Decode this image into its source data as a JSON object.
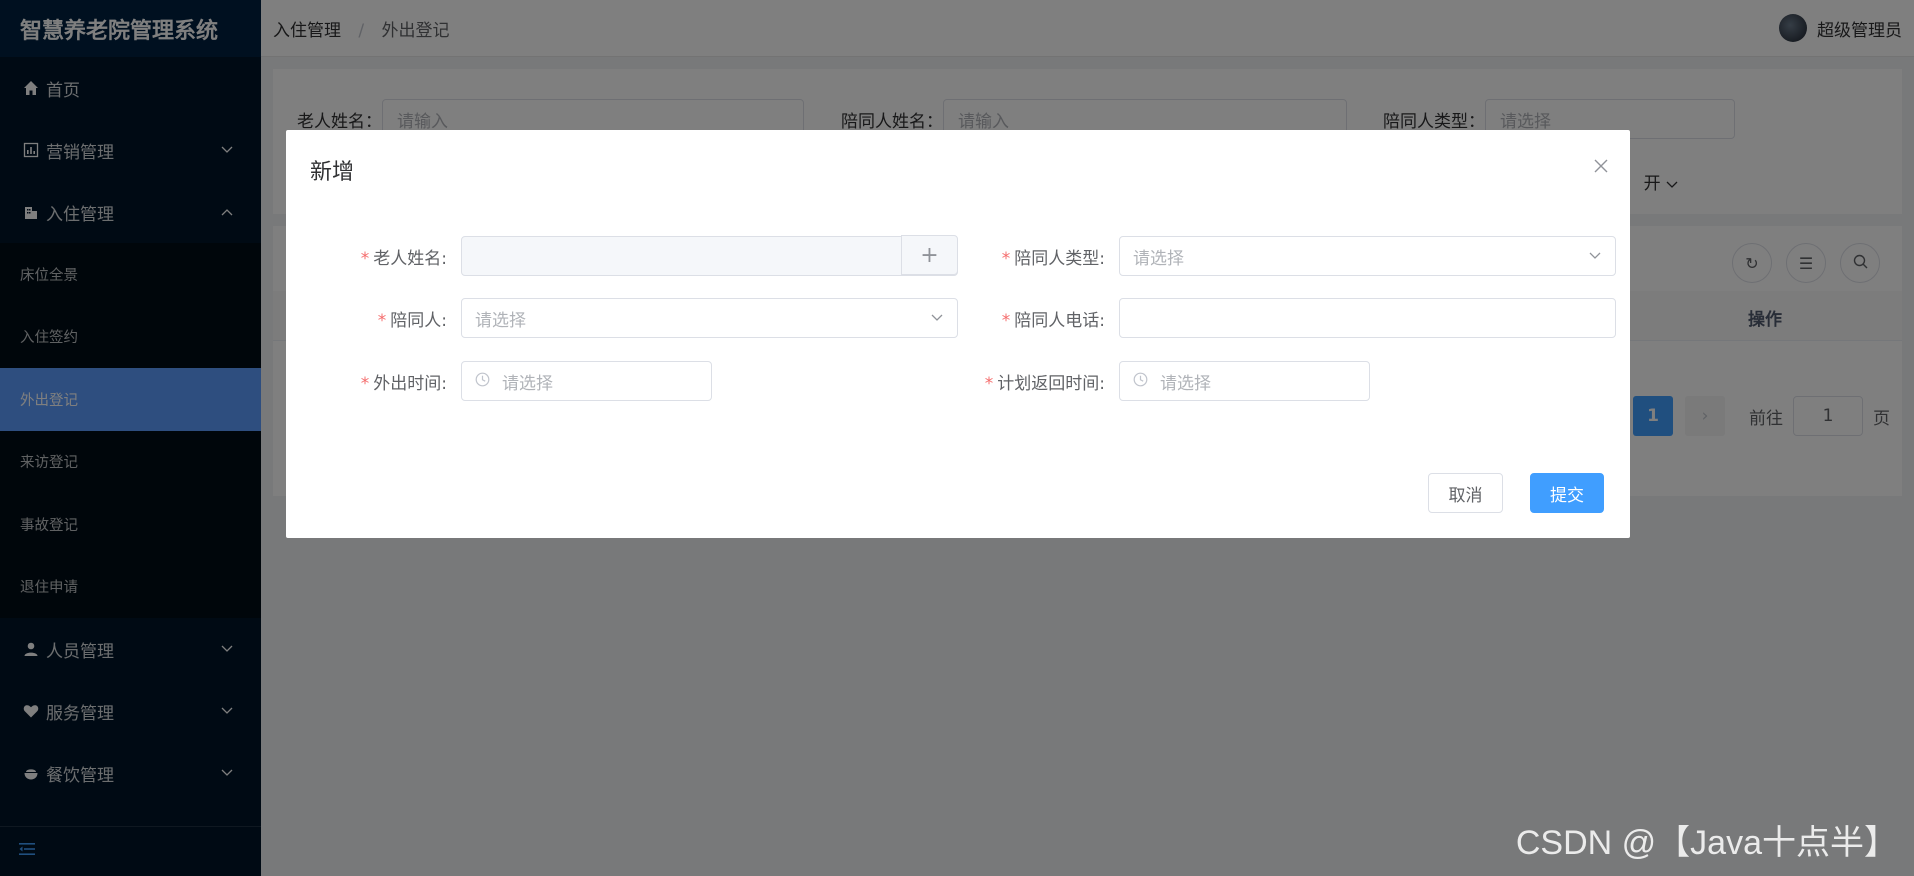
{
  "app": {
    "title": "智慧养老院管理系统"
  },
  "sidebar": {
    "items": [
      {
        "label": "首页",
        "icon": "home-icon"
      },
      {
        "label": "营销管理",
        "icon": "chart-icon"
      },
      {
        "label": "入住管理",
        "icon": "building-icon"
      },
      {
        "label": "人员管理",
        "icon": "person-icon"
      },
      {
        "label": "服务管理",
        "icon": "heart-icon"
      },
      {
        "label": "餐饮管理",
        "icon": "bowl-icon"
      }
    ],
    "submenu": [
      {
        "label": "床位全景"
      },
      {
        "label": "入住签约"
      },
      {
        "label": "外出登记",
        "active": true
      },
      {
        "label": "来访登记"
      },
      {
        "label": "事故登记"
      },
      {
        "label": "退住申请"
      }
    ],
    "active_color": "#5c9dff"
  },
  "header": {
    "breadcrumb": [
      "入住管理",
      "外出登记"
    ],
    "breadcrumb_sep": "/",
    "user": "超级管理员"
  },
  "search": {
    "elder_name_label": "老人姓名：",
    "elder_name_placeholder": "请输入",
    "companion_name_label": "陪同人姓名：",
    "companion_name_placeholder": "请输入",
    "companion_type_label": "陪同人类型：",
    "companion_type_placeholder": "请选择",
    "expand_label": "开"
  },
  "table": {
    "op_header": "操作"
  },
  "pagination": {
    "current_page": "1",
    "goto_label": "前往",
    "goto_value": "1",
    "page_unit": "页"
  },
  "dialog": {
    "title": "新增",
    "required_mark": "*",
    "fields": {
      "elder_name": {
        "label": "老人姓名:",
        "value": ""
      },
      "companion_type": {
        "label": "陪同人类型:",
        "placeholder": "请选择"
      },
      "companion": {
        "label": "陪同人:",
        "placeholder": "请选择"
      },
      "companion_phone": {
        "label": "陪同人电话:",
        "value": ""
      },
      "out_time": {
        "label": "外出时间:",
        "placeholder": "请选择"
      },
      "return_time": {
        "label": "计划返回时间:",
        "placeholder": "请选择"
      }
    },
    "cancel_label": "取消",
    "submit_label": "提交"
  },
  "watermark": "CSDN @【Java十点半】",
  "colors": {
    "primary": "#409eff",
    "sidebar_bg": "#001529",
    "required": "#f56c6c"
  }
}
